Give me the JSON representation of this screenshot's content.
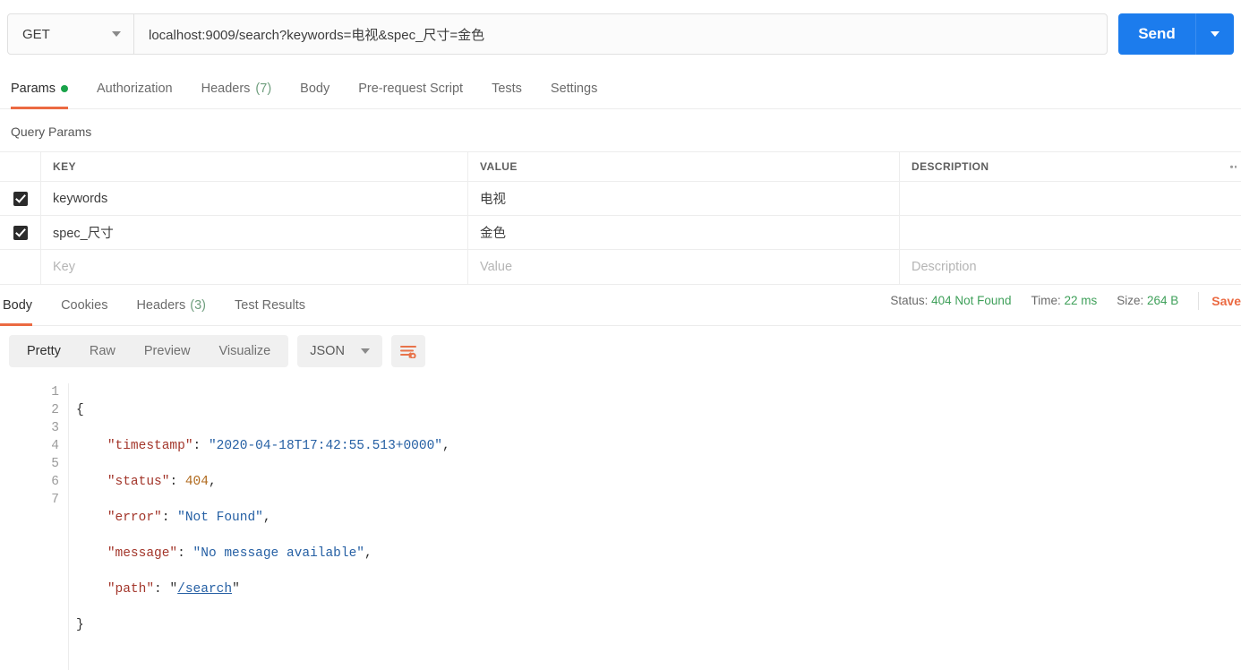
{
  "request": {
    "method": "GET",
    "url": "localhost:9009/search?keywords=电视&spec_尺寸=金色",
    "send_label": "Send"
  },
  "request_tabs": [
    {
      "label": "Params",
      "badge": "dot",
      "active": true
    },
    {
      "label": "Authorization",
      "badge": "",
      "active": false
    },
    {
      "label": "Headers",
      "badge": "(7)",
      "active": false
    },
    {
      "label": "Body",
      "badge": "",
      "active": false
    },
    {
      "label": "Pre-request Script",
      "badge": "",
      "active": false
    },
    {
      "label": "Tests",
      "badge": "",
      "active": false
    },
    {
      "label": "Settings",
      "badge": "",
      "active": false
    }
  ],
  "query_params": {
    "section_title": "Query Params",
    "headers": {
      "key": "KEY",
      "value": "VALUE",
      "description": "DESCRIPTION"
    },
    "rows": [
      {
        "checked": true,
        "key": "keywords",
        "value": "电视",
        "description": ""
      },
      {
        "checked": true,
        "key": "spec_尺寸",
        "value": "金色",
        "description": ""
      }
    ],
    "placeholder_row": {
      "key": "Key",
      "value": "Value",
      "description": "Description"
    }
  },
  "response_tabs": [
    {
      "label": "Body",
      "badge": "",
      "active": true
    },
    {
      "label": "Cookies",
      "badge": "",
      "active": false
    },
    {
      "label": "Headers",
      "badge": "(3)",
      "active": false
    },
    {
      "label": "Test Results",
      "badge": "",
      "active": false
    }
  ],
  "response_meta": {
    "status_label": "Status:",
    "status_value": "404 Not Found",
    "time_label": "Time:",
    "time_value": "22 ms",
    "size_label": "Size:",
    "size_value": "264 B",
    "save_label": "Save"
  },
  "viewer": {
    "modes": [
      {
        "label": "Pretty",
        "active": true
      },
      {
        "label": "Raw",
        "active": false
      },
      {
        "label": "Preview",
        "active": false
      },
      {
        "label": "Visualize",
        "active": false
      }
    ],
    "format": "JSON"
  },
  "body_code": {
    "line_numbers": [
      "1",
      "2",
      "3",
      "4",
      "5",
      "6",
      "7"
    ],
    "json": {
      "timestamp": "2020-04-18T17:42:55.513+0000",
      "status": 404,
      "error": "Not Found",
      "message": "No message available",
      "path": "/search"
    }
  },
  "colors": {
    "accent_orange": "#eb6a42",
    "send_blue": "#1c7ced",
    "status_green": "#3fa05a",
    "dot_green": "#1aa34a"
  }
}
